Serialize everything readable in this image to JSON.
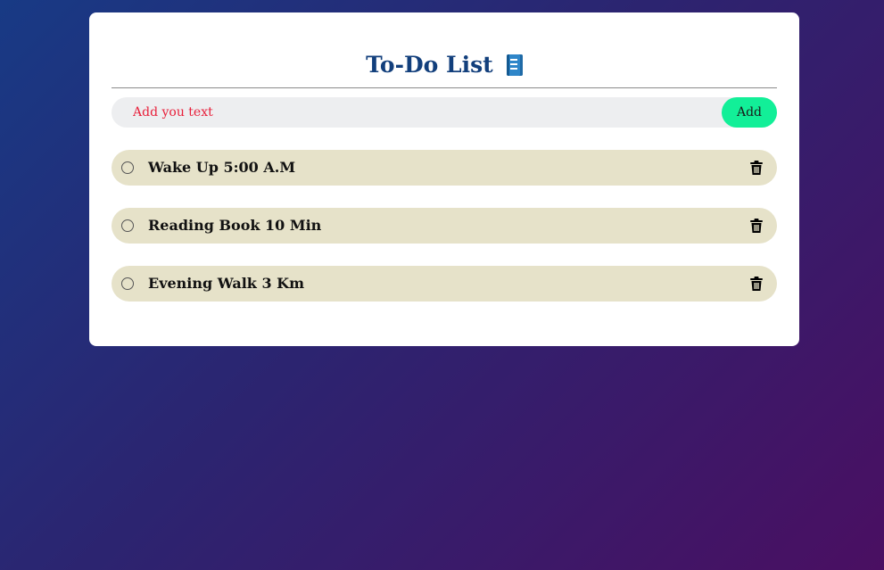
{
  "app": {
    "title": "To-Do List",
    "title_icon": "notebook-icon"
  },
  "input": {
    "value": "",
    "placeholder": "Add you text",
    "placeholder_color": "#e8203b"
  },
  "add_button": {
    "label": "Add",
    "color": "#12ef98"
  },
  "tasks": [
    {
      "text": "Wake Up 5:00 A.M",
      "checked": false,
      "delete_icon": "trash-icon"
    },
    {
      "text": "Reading Book 10 Min",
      "checked": false,
      "delete_icon": "trash-icon"
    },
    {
      "text": "Evening Walk 3 Km",
      "checked": false,
      "delete_icon": "trash-icon"
    }
  ],
  "colors": {
    "title": "#123f7c",
    "task_background": "#e6e2c9",
    "input_background": "#edeef0",
    "background_start": "#183a85",
    "background_end": "#4a0f62"
  }
}
